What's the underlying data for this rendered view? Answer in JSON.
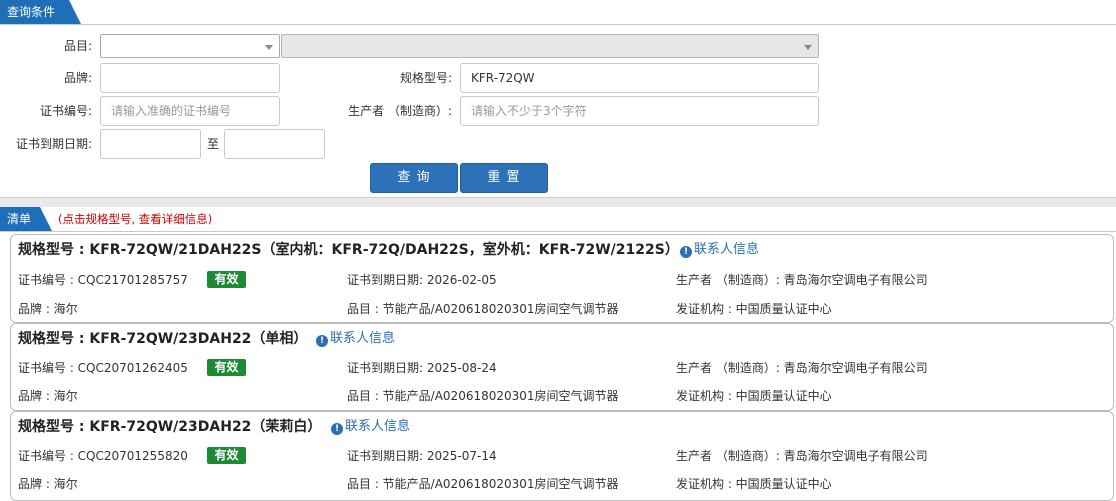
{
  "query": {
    "section_title": "查询条件",
    "category_label": "品目:",
    "brand_label": "品牌:",
    "brand_value": "",
    "model_label": "规格型号:",
    "model_value": "KFR-72QW",
    "cert_no_label": "证书编号:",
    "cert_no_placeholder": "请输入准确的证书编号",
    "manufacturer_label": "生产者 （制造商）:",
    "manufacturer_placeholder": "请输入不少于3个字符",
    "expiry_label": "证书到期日期:",
    "expiry_to": "至",
    "search_button": "查 询",
    "reset_button": "重 置"
  },
  "list": {
    "section_title": "清单",
    "hint": "(点击规格型号, 查看详细信息)",
    "contact_label": "联系人信息",
    "items": [
      {
        "title": "规格型号 : KFR-72QW/21DAH22S（室内机：KFR-72Q/DAH22S，室外机：KFR-72W/2122S）",
        "cert_no": "证书编号 : CQC21701285757",
        "status": "有效",
        "expiry": "证书到期日期: 2026-02-05",
        "manufacturer": "生产者 （制造商）: 青岛海尔空调电子有限公司",
        "brand": "品牌 : 海尔",
        "category": "品目 : 节能产品/A020618020301房间空气调节器",
        "issuer": "发证机构 : 中国质量认证中心"
      },
      {
        "title": "规格型号 : KFR-72QW/23DAH22（单相）",
        "cert_no": "证书编号 : CQC20701262405",
        "status": "有效",
        "expiry": "证书到期日期: 2025-08-24",
        "manufacturer": "生产者 （制造商）: 青岛海尔空调电子有限公司",
        "brand": "品牌 : 海尔",
        "category": "品目 : 节能产品/A020618020301房间空气调节器",
        "issuer": "发证机构 : 中国质量认证中心"
      },
      {
        "title": "规格型号 : KFR-72QW/23DAH22（茉莉白）",
        "cert_no": "证书编号 : CQC20701255820",
        "status": "有效",
        "expiry": "证书到期日期: 2025-07-14",
        "manufacturer": "生产者 （制造商）: 青岛海尔空调电子有限公司",
        "brand": "品牌 : 海尔",
        "category": "品目 : 节能产品/A020618020301房间空气调节器",
        "issuer": "发证机构 : 中国质量认证中心"
      }
    ]
  },
  "colors": {
    "accent": "#1f6fb8",
    "status_valid": "#1e8a35",
    "hint": "#d00000",
    "link": "#2a6fb4"
  },
  "icons": {
    "contact": "info-circle-icon",
    "dropdown": "chevron-down-icon"
  }
}
